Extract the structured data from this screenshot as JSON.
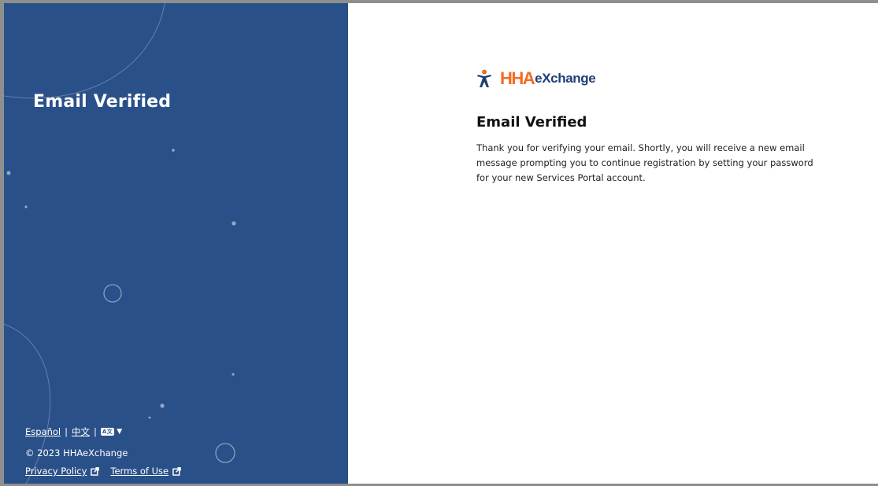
{
  "left_panel": {
    "title": "Email Verified",
    "languages": {
      "spanish": "Español",
      "chinese": "中文",
      "separator": "|",
      "selector_icon": "language-selector-icon"
    },
    "copyright": "© 2023 HHAeXchange",
    "links": {
      "privacy": "Privacy Policy",
      "terms": "Terms of Use"
    },
    "background_color": "#2a5089"
  },
  "logo": {
    "hha": "HHA",
    "exchange": "eXchange",
    "icon": "person-star-logo-icon",
    "primary_color": "#f26b21",
    "secondary_color": "#1f3e74"
  },
  "main": {
    "title": "Email Verified",
    "message": "Thank you for verifying your email. Shortly, you will receive a new email message prompting you to continue registration by setting your password for your new Services Portal account."
  }
}
